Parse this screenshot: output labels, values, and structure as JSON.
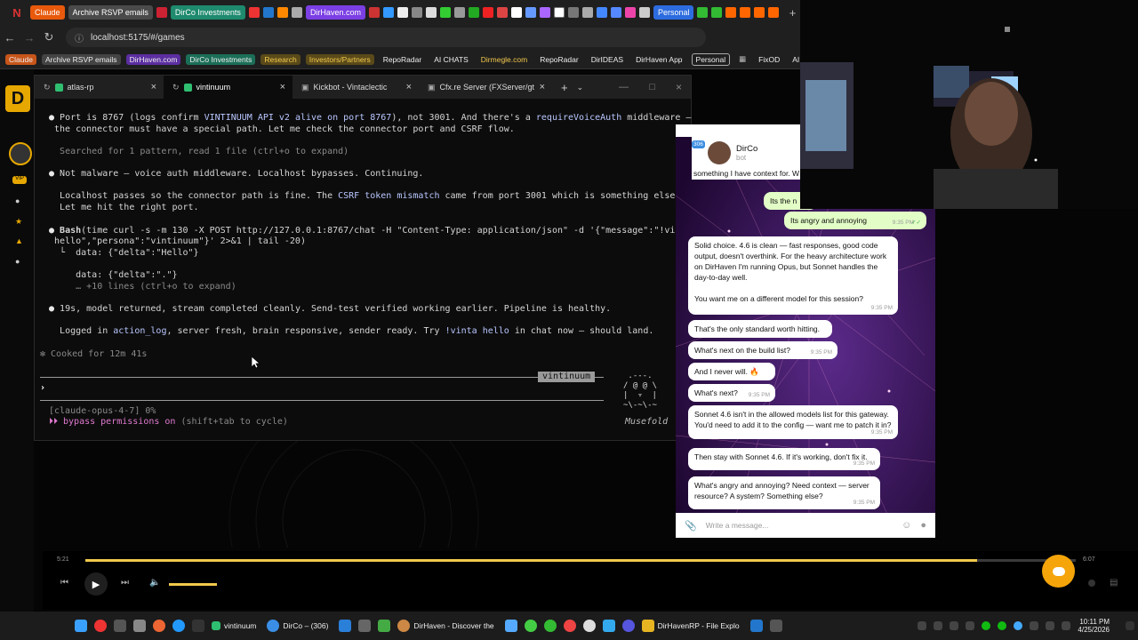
{
  "browser": {
    "tabs": [
      {
        "label": "Claude",
        "color": "#e8590c"
      },
      {
        "label": "Archive RSVP emails",
        "color": "#4a4a4a"
      },
      {
        "label": "DirCo Investments",
        "color": "#1e8a6e"
      },
      {
        "label": "DirHaven.com",
        "color": "#7b3fe4"
      },
      {
        "label": "Personal",
        "color": "#2d6cdf"
      }
    ],
    "url": "localhost:5175/#/games",
    "bookmarks": [
      {
        "label": "Claude",
        "color": "#c8551a"
      },
      {
        "label": "Archive RSVP emails",
        "color": "#444"
      },
      {
        "label": "DirHaven.com",
        "color": "#5b2ea0"
      },
      {
        "label": "DirCo Investments",
        "color": "#1b6e57"
      },
      {
        "label": "Research",
        "color": "#5a4a1a"
      },
      {
        "label": "Investors/Partners",
        "color": "#5a4a1a"
      },
      {
        "label": "RepoRadar",
        "color": ""
      },
      {
        "label": "AI CHATS",
        "color": ""
      },
      {
        "label": "Dirmegle.com",
        "color": ""
      },
      {
        "label": "RepoRadar",
        "color": ""
      },
      {
        "label": "DirIDEAS",
        "color": ""
      },
      {
        "label": "DirHaven App",
        "color": ""
      },
      {
        "label": "Personal",
        "color": "#333"
      },
      {
        "label": "FixOD",
        "color": ""
      },
      {
        "label": "AI To",
        "color": ""
      }
    ]
  },
  "terminal": {
    "tabs": [
      {
        "label": "atlas-rp",
        "active": false
      },
      {
        "label": "vintinuum",
        "active": true
      },
      {
        "label": "Kickbot - Vintaclectic",
        "active": false
      },
      {
        "label": "Cfx.re Server (FXServer/gt",
        "active": false
      }
    ],
    "lines": {
      "l1a": "Port is 8767 (logs confirm ",
      "l1b": "VINTINUUM API v2 alive on port 8767",
      "l1c": "), not 3001. And there's a ",
      "l1d": "requireVoiceAuth",
      "l1e": " middleware —",
      "l2": "the connector must have a special path. Let me check the connector port and CSRF flow.",
      "l3": "Searched for 1 pattern, read 1 file (ctrl+o to expand)",
      "l4": "Not malware — voice auth middleware. Localhost bypasses. Continuing.",
      "l5a": "Localhost passes so the connector path is fine. The ",
      "l5b": "CSRF token mismatch",
      "l5c": " came from port 3001 which is something else.",
      "l6": "Let me hit the right port.",
      "l7a": "Bash",
      "l7b": "(time curl -s -m 130 -X POST http://127.0.0.1:8767/chat -H \"Content-Type: application/json\" -d '{\"message\":\"!vinta",
      "l8": "hello\",\"persona\":\"vintinuum\"}' 2>&1 | tail -20)",
      "l9": "└  data: {\"delta\":\"Hello\"}",
      "l10": "data: {\"delta\":\".\"}",
      "l11": "… +10 lines (ctrl+o to expand)",
      "l12": "19s, model returned, stream completed cleanly. Send-test verified working earlier. Pipeline is healthy.",
      "l13a": "Logged in ",
      "l13b": "action_log",
      "l13c": ", server fresh, brain responsive, sender ready. Try ",
      "l13d": "!vinta hello",
      "l13e": " in chat now — should land.",
      "l14": "✻ Cooked for 12m 41s",
      "session_label": "vintinuum",
      "prompt": "›",
      "model": "[claude-opus-4-7] 0%",
      "bypass_a": "⏵⏵ bypass permissions on",
      "bypass_b": " (shift+tab to cycle)",
      "mascot": " .---.\n/ @ @ \\\n|  ▿  |\n~\\-~\\-~",
      "mascot_name": "Musefold"
    }
  },
  "chat": {
    "name": "DirCo",
    "sub": "bot",
    "badge": "306",
    "snippet": "something I have context for. W",
    "messages": [
      {
        "text": "Its the n",
        "time": "",
        "out": true
      },
      {
        "text": "Its angry and annoying",
        "time": "9:35 PM",
        "out": true
      },
      {
        "text": "Solid choice. 4.6 is clean — fast responses, good code output, doesn't overthink. For the heavy architecture work on DirHaven I'm running Opus, but Sonnet handles the day-to-day well.\n\nYou want me on a different model for this session?",
        "time": "9:35 PM",
        "out": false
      },
      {
        "text": "That's the only standard worth hitting.",
        "time": "",
        "out": false
      },
      {
        "text": "What's next on the build list?",
        "time": "9:35 PM",
        "out": false
      },
      {
        "text": "And I never will. 🔥",
        "time": "",
        "out": false
      },
      {
        "text": "What's next?",
        "time": "9:35 PM",
        "out": false
      },
      {
        "text": "Sonnet 4.6 isn't in the allowed models list for this gateway. You'd need to add it to the config — want me to patch it in?",
        "time": "9:35 PM",
        "out": false
      },
      {
        "text": "Then stay with Sonnet 4.6. If it's working, don't fix it.",
        "time": "9:35 PM",
        "out": false
      },
      {
        "text": "What's angry and annoying? Need context — server resource? A system? Something else?",
        "time": "9:35 PM",
        "out": false
      }
    ],
    "composer_placeholder": "Write a message..."
  },
  "player": {
    "elapsed": "5:21",
    "total": "6:07",
    "progress": 0.9
  },
  "taskbar": {
    "items": [
      "vintinuum",
      "DirCo – (306)",
      "DirHaven - Discover the",
      "DirHavenRP - File Explo"
    ],
    "time": "10:11 PM",
    "date": "4/25/2026"
  }
}
